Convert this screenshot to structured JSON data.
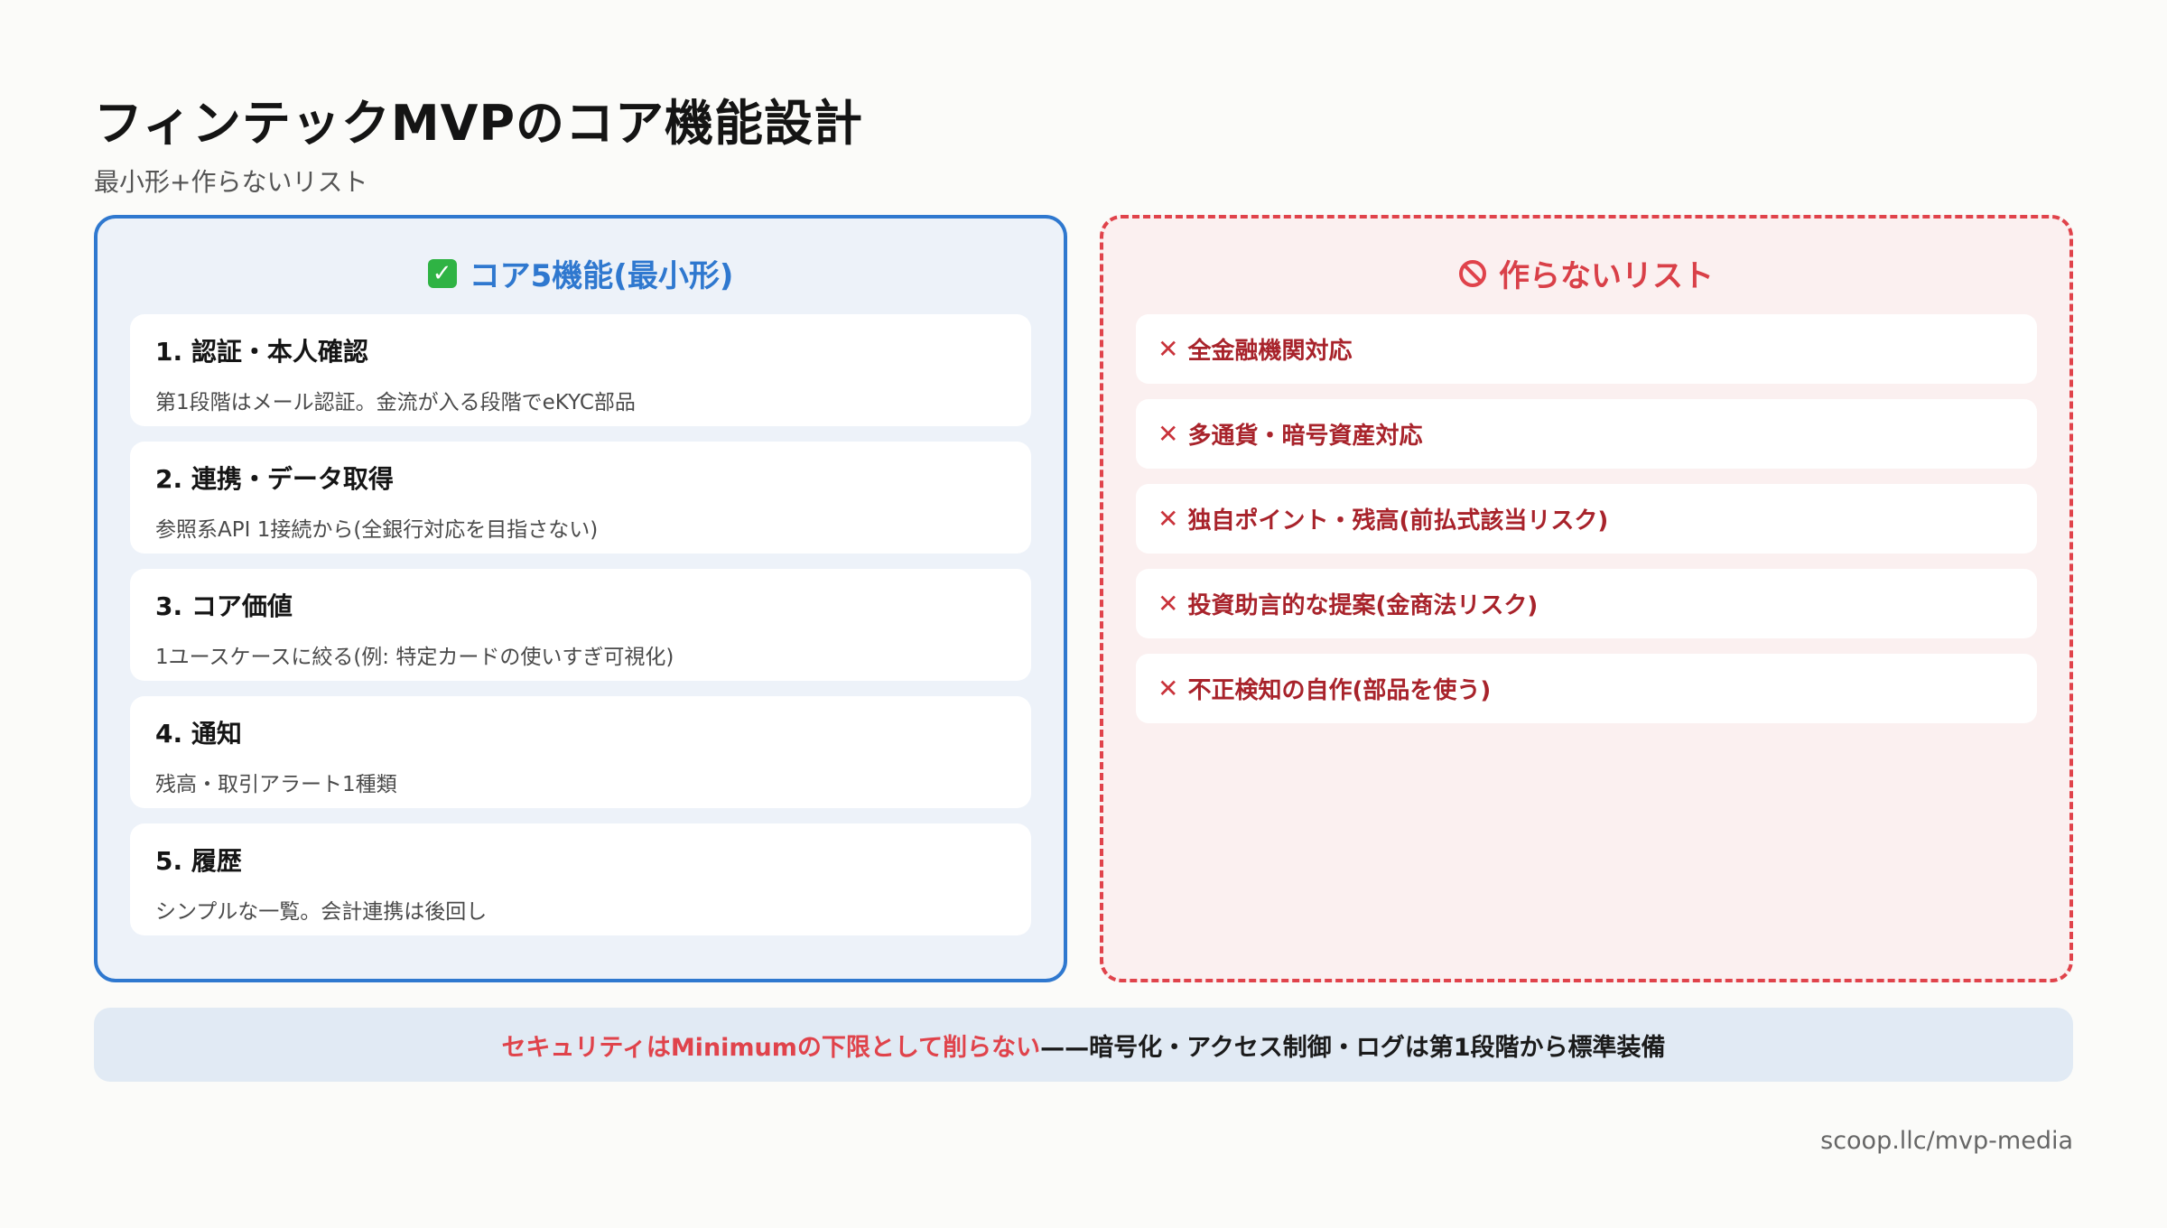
{
  "header": {
    "title": "フィンテックMVPのコア機能設計",
    "subtitle": "最小形+作らないリスト"
  },
  "core_panel": {
    "heading": "コア5機能(最小形)",
    "icon": "check-mark-icon",
    "accent_color": "#2f78cf",
    "items": [
      {
        "title": "1. 認証・本人確認",
        "desc": "第1段階はメール認証。金流が入る段階でeKYC部品"
      },
      {
        "title": "2. 連携・データ取得",
        "desc": "参照系API 1接続から(全銀行対応を目指さない)"
      },
      {
        "title": "3. コア価値",
        "desc": "1ユースケースに絞る(例: 特定カードの使いすぎ可視化)"
      },
      {
        "title": "4. 通知",
        "desc": "残高・取引アラート1種類"
      },
      {
        "title": "5. 履歴",
        "desc": "シンプルな一覧。会計連携は後回し"
      }
    ]
  },
  "avoid_panel": {
    "heading": "作らないリスト",
    "icon": "no-entry-icon",
    "accent_color": "#e0434b",
    "mark": "✕",
    "items": [
      "全金融機関対応",
      "多通貨・暗号資産対応",
      "独自ポイント・残高(前払式該当リスク)",
      "投資助言的な提案(金商法リスク)",
      "不正検知の自作(部品を使う)"
    ]
  },
  "banner": {
    "emphasis": "セキュリティはMinimumの下限として削らない",
    "rest": "——暗号化・アクセス制御・ログは第1段階から標準装備"
  },
  "footer": {
    "url": "scoop.llc/mvp-media"
  }
}
